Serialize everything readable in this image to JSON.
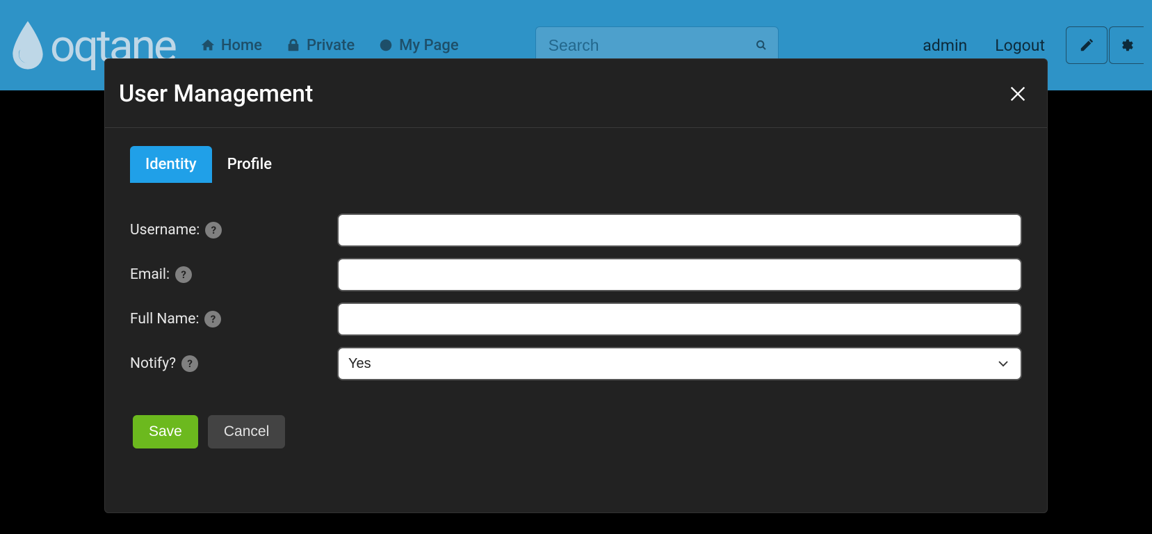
{
  "brand": {
    "name": "oqtane"
  },
  "nav": {
    "items": [
      {
        "label": "Home",
        "icon": "home"
      },
      {
        "label": "Private",
        "icon": "lock"
      },
      {
        "label": "My Page",
        "icon": "target"
      }
    ]
  },
  "search": {
    "placeholder": "Search"
  },
  "user_links": {
    "user": "admin",
    "logout": "Logout"
  },
  "modal": {
    "title": "User Management",
    "tabs": [
      {
        "label": "Identity",
        "active": true
      },
      {
        "label": "Profile",
        "active": false
      }
    ],
    "fields": {
      "username": {
        "label": "Username:",
        "value": ""
      },
      "email": {
        "label": "Email:",
        "value": ""
      },
      "full_name": {
        "label": "Full Name:",
        "value": ""
      },
      "notify": {
        "label": "Notify?",
        "value": "Yes"
      }
    },
    "buttons": {
      "save": "Save",
      "cancel": "Cancel"
    }
  }
}
